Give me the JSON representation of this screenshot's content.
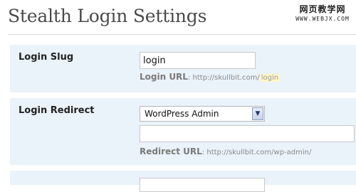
{
  "header": {
    "title": "Stealth Login Settings",
    "watermark_line1": "网页教学网",
    "watermark_line2": "WWW.WEBJX.COM"
  },
  "settings": {
    "login_slug": {
      "label": "Login Slug",
      "value": "login",
      "hint_label": "Login URL",
      "hint_sep": ":",
      "hint_prefix": "http://skullbit.com/",
      "hint_highlight": "login"
    },
    "login_redirect": {
      "label": "Login Redirect",
      "selected_option": "WordPress Admin",
      "custom_url_value": "",
      "hint_label": "Redirect URL",
      "hint_sep": ":",
      "hint_value": "http://skullbit.com/wp-admin/"
    }
  },
  "colors": {
    "row_background": "#eaf2fa",
    "title_color": "#4a4a4a",
    "highlight": "#fff7c8"
  }
}
